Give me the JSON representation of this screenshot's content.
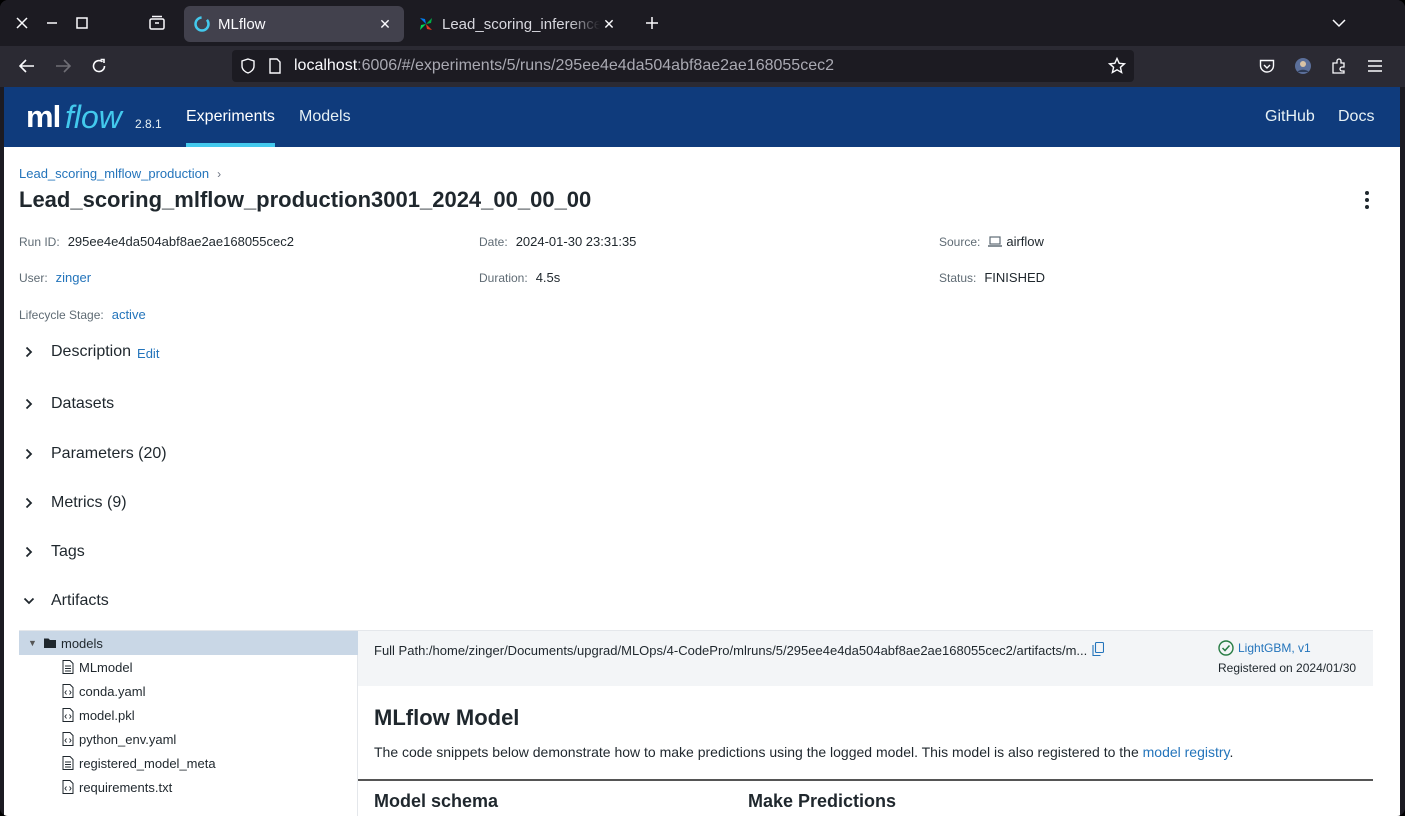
{
  "browser": {
    "tabs": [
      {
        "title": "MLflow",
        "active": true
      },
      {
        "title": "Lead_scoring_inference",
        "active": false
      }
    ],
    "url_host": "localhost",
    "url_rest": ":6006/#/experiments/5/runs/295ee4e4da504abf8ae2ae168055cec2"
  },
  "header": {
    "logo_ml": "ml",
    "logo_flow": "flow",
    "version": "2.8.1",
    "nav": [
      "Experiments",
      "Models"
    ],
    "right_links": [
      "GitHub",
      "Docs"
    ],
    "colors": {
      "bar": "#0f3b7c",
      "accent": "#43c9ed"
    }
  },
  "breadcrumb": {
    "experiment": "Lead_scoring_mlflow_production"
  },
  "title": "Lead_scoring_mlflow_production3001_2024_00_00_00",
  "meta": {
    "run_id_label": "Run ID:",
    "run_id": "295ee4e4da504abf8ae2ae168055cec2",
    "date_label": "Date:",
    "date": "2024-01-30 23:31:35",
    "source_label": "Source:",
    "source": "airflow",
    "user_label": "User:",
    "user": "zinger",
    "duration_label": "Duration:",
    "duration": "4.5s",
    "status_label": "Status:",
    "status": "FINISHED",
    "lifecycle_label": "Lifecycle Stage:",
    "lifecycle": "active"
  },
  "sections": {
    "description": "Description",
    "description_edit": "Edit",
    "datasets": "Datasets",
    "parameters": "Parameters (20)",
    "metrics": "Metrics (9)",
    "tags": "Tags",
    "artifacts": "Artifacts"
  },
  "artifacts": {
    "tree": [
      {
        "name": "models",
        "type": "folder"
      },
      {
        "name": "MLmodel",
        "type": "file"
      },
      {
        "name": "conda.yaml",
        "type": "code"
      },
      {
        "name": "model.pkl",
        "type": "code"
      },
      {
        "name": "python_env.yaml",
        "type": "code"
      },
      {
        "name": "registered_model_meta",
        "type": "file"
      },
      {
        "name": "requirements.txt",
        "type": "code"
      }
    ],
    "full_path": "Full Path:/home/zinger/Documents/upgrad/MLOps/4-CodePro/mlruns/5/295ee4e4da504abf8ae2ae168055cec2/artifacts/m...",
    "registered_model": "LightGBM, v1",
    "registered_on": "Registered on 2024/01/30",
    "model_title": "MLflow Model",
    "model_desc": "The code snippets below demonstrate how to make predictions using the logged model. This model is also registered to the ",
    "model_registry_link": "model registry",
    "model_desc_end": ".",
    "schema_title": "Model schema",
    "predict_title": "Make Predictions"
  }
}
